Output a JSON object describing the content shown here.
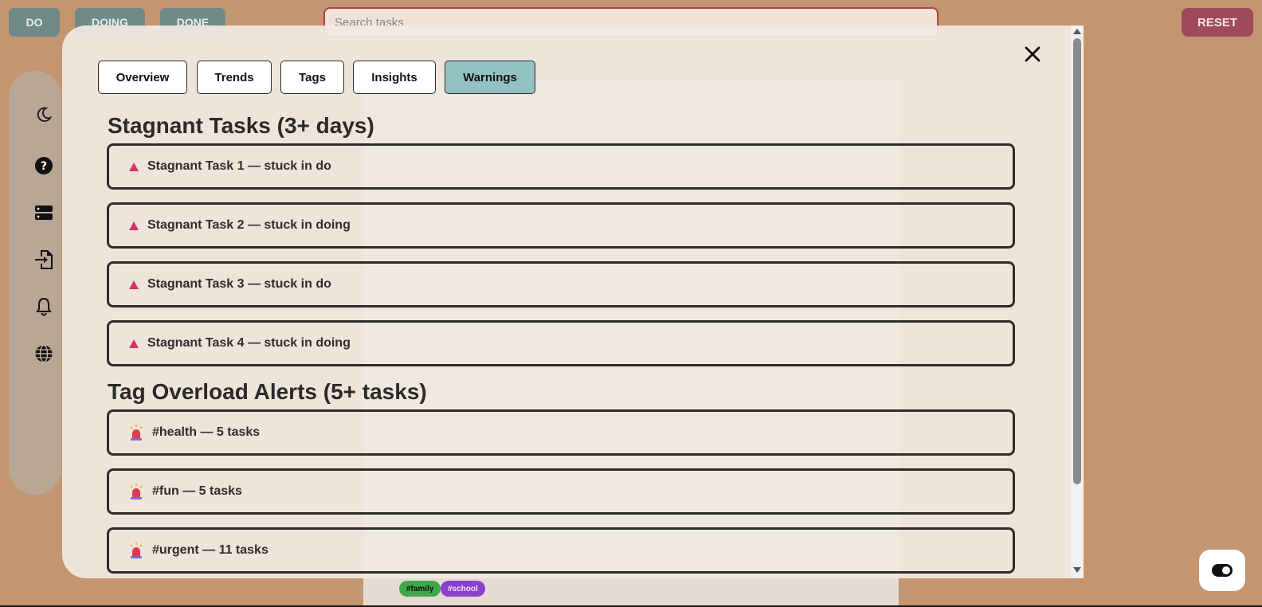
{
  "topbar": {
    "filters": [
      "DO",
      "DOING",
      "DONE"
    ],
    "search_placeholder": "Search tasks",
    "reset_label": "RESET"
  },
  "sidebar": {
    "icons": [
      "moon-icon",
      "help-icon",
      "storage-icon",
      "import-icon",
      "bell-icon",
      "globe-icon"
    ]
  },
  "background": {
    "tags": [
      "#family",
      "#school"
    ]
  },
  "modal": {
    "close_label": "✕",
    "tabs": [
      "Overview",
      "Trends",
      "Tags",
      "Insights",
      "Warnings"
    ],
    "active_tab": "Warnings",
    "stagnant": {
      "title": "Stagnant Tasks (3+ days)",
      "items": [
        "Stagnant Task 1 — stuck in do",
        "Stagnant Task 2 — stuck in doing",
        "Stagnant Task 3 — stuck in do",
        "Stagnant Task 4 — stuck in doing"
      ]
    },
    "overload": {
      "title": "Tag Overload Alerts (5+ tasks)",
      "items": [
        "#health — 5 tasks",
        "#fun — 5 tasks",
        "#urgent — 11 tasks"
      ]
    }
  },
  "colors": {
    "background": "#c49571",
    "filter_button": "#6f8a87",
    "reset_button": "#9e4a5c",
    "active_tab": "#93c2c4",
    "warning_triangle": "#d6336c"
  }
}
